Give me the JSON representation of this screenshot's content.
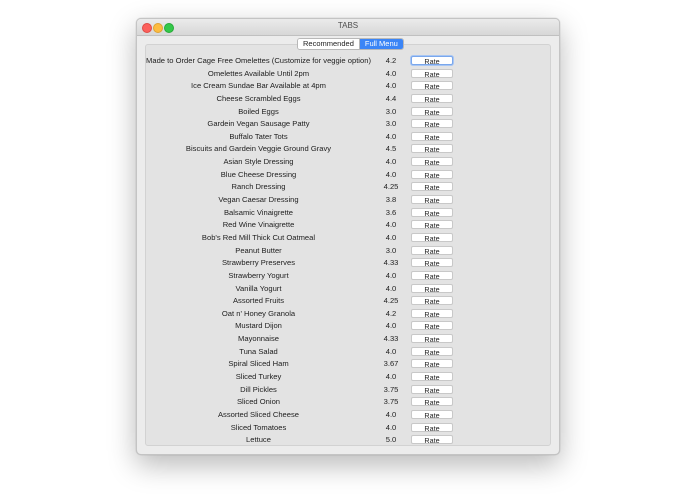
{
  "window": {
    "title": "TABS"
  },
  "tabs": [
    {
      "label": "Recommended",
      "active": false
    },
    {
      "label": "Full Menu",
      "active": true
    }
  ],
  "rate_label": "Rate",
  "colors": {
    "accent": "#3b85f6",
    "close": "#fc605b",
    "minimize": "#fdbc40",
    "maximize": "#34c84a"
  },
  "items": [
    {
      "name": "Made to Order Cage Free Omelettes (Customize for veggie option)",
      "rating": "4.2"
    },
    {
      "name": "Omelettes Available Until 2pm",
      "rating": "4.0"
    },
    {
      "name": "Ice Cream Sundae Bar Available at 4pm",
      "rating": "4.0"
    },
    {
      "name": "Cheese Scrambled Eggs",
      "rating": "4.4"
    },
    {
      "name": "Boiled Eggs",
      "rating": "3.0"
    },
    {
      "name": "Gardein Vegan Sausage Patty",
      "rating": "3.0"
    },
    {
      "name": "Buffalo Tater Tots",
      "rating": "4.0"
    },
    {
      "name": "Biscuits and Gardein Veggie Ground Gravy",
      "rating": "4.5"
    },
    {
      "name": "Asian Style Dressing",
      "rating": "4.0"
    },
    {
      "name": "Blue Cheese Dressing",
      "rating": "4.0"
    },
    {
      "name": "Ranch Dressing",
      "rating": "4.25"
    },
    {
      "name": "Vegan Caesar Dressing",
      "rating": "3.8"
    },
    {
      "name": "Balsamic Vinaigrette",
      "rating": "3.6"
    },
    {
      "name": "Red Wine Vinaigrette",
      "rating": "4.0"
    },
    {
      "name": "Bob's Red Mill Thick Cut Oatmeal",
      "rating": "4.0"
    },
    {
      "name": "Peanut Butter",
      "rating": "3.0"
    },
    {
      "name": "Strawberry Preserves",
      "rating": "4.33"
    },
    {
      "name": "Strawberry Yogurt",
      "rating": "4.0"
    },
    {
      "name": "Vanilla Yogurt",
      "rating": "4.0"
    },
    {
      "name": "Assorted Fruits",
      "rating": "4.25"
    },
    {
      "name": "Oat n' Honey Granola",
      "rating": "4.2"
    },
    {
      "name": "Mustard Dijon",
      "rating": "4.0"
    },
    {
      "name": "Mayonnaise",
      "rating": "4.33"
    },
    {
      "name": "Tuna Salad",
      "rating": "4.0"
    },
    {
      "name": "Spiral Sliced Ham",
      "rating": "3.67"
    },
    {
      "name": "Sliced Turkey",
      "rating": "4.0"
    },
    {
      "name": "Dill Pickles",
      "rating": "3.75"
    },
    {
      "name": "Sliced Onion",
      "rating": "3.75"
    },
    {
      "name": "Assorted Sliced Cheese",
      "rating": "4.0"
    },
    {
      "name": "Sliced Tomatoes",
      "rating": "4.0"
    },
    {
      "name": "Lettuce",
      "rating": "5.0"
    }
  ]
}
